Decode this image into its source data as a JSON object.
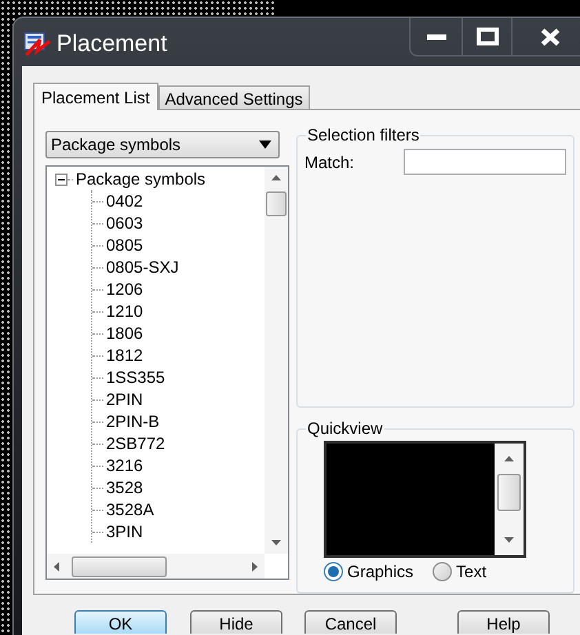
{
  "window": {
    "title": "Placement"
  },
  "tabs": [
    {
      "label": "Placement List",
      "selected": true
    },
    {
      "label": "Advanced Settings",
      "selected": false
    }
  ],
  "list_filter": {
    "value": "Package symbols"
  },
  "tree": [
    {
      "label": "Package symbols",
      "expanded": true,
      "children": [
        {
          "label": "0402"
        },
        {
          "label": "0603"
        },
        {
          "label": "0805"
        },
        {
          "label": "0805-SXJ"
        },
        {
          "label": "1206"
        },
        {
          "label": "1210"
        },
        {
          "label": "1806"
        },
        {
          "label": "1812"
        },
        {
          "label": "1SS355"
        },
        {
          "label": "2PIN"
        },
        {
          "label": "2PIN-B"
        },
        {
          "label": "2SB772"
        },
        {
          "label": "3216"
        },
        {
          "label": "3528"
        },
        {
          "label": "3528A"
        },
        {
          "label": "3PIN"
        }
      ]
    }
  ],
  "selection_filters": {
    "title": "Selection filters",
    "match_label": "Match:"
  },
  "quickview": {
    "title": "Quickview",
    "options": [
      {
        "label": "Graphics",
        "selected": true
      },
      {
        "label": "Text",
        "selected": false
      }
    ]
  },
  "buttons": [
    {
      "label": "OK",
      "default": true
    },
    {
      "label": "Hide",
      "default": false
    },
    {
      "label": "Cancel",
      "default": false
    },
    {
      "label": "Help",
      "default": false
    }
  ]
}
